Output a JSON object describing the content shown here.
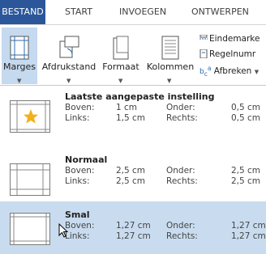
{
  "ribbon": {
    "tabs": [
      {
        "label": "BESTAND"
      },
      {
        "label": "START"
      },
      {
        "label": "INVOEGEN"
      },
      {
        "label": "ONTWERPEN"
      }
    ],
    "active_tab_color": "#2b579a",
    "commands": {
      "margins": "Marges",
      "orientation": "Afdrukstand",
      "size": "Formaat",
      "columns": "Kolommen",
      "breaks": "Eindemarke",
      "line_numbers": "Regelnumr",
      "hyphenation": "Afbreken"
    }
  },
  "gallery": {
    "selection_color": "#c9dcef",
    "items": [
      {
        "name": "Laatste aangepaste instelling",
        "top_label": "Boven:",
        "top": "1 cm",
        "bottom_label": "Onder:",
        "bottom": "0,5 cm",
        "left_label": "Links:",
        "left": "1,5 cm",
        "right_label": "Rechts:",
        "right": "0,5 cm"
      },
      {
        "name": "Normaal",
        "top_label": "Boven:",
        "top": "2,5 cm",
        "bottom_label": "Onder:",
        "bottom": "2,5 cm",
        "left_label": "Links:",
        "left": "2,5 cm",
        "right_label": "Rechts:",
        "right": "2,5 cm"
      },
      {
        "name": "Smal",
        "top_label": "Boven:",
        "top": "1,27 cm",
        "bottom_label": "Onder:",
        "bottom": "1,27 cm",
        "left_label": "Links:",
        "left": "1,27 cm",
        "right_label": "Rechts:",
        "right": "1,27 cm"
      }
    ]
  }
}
